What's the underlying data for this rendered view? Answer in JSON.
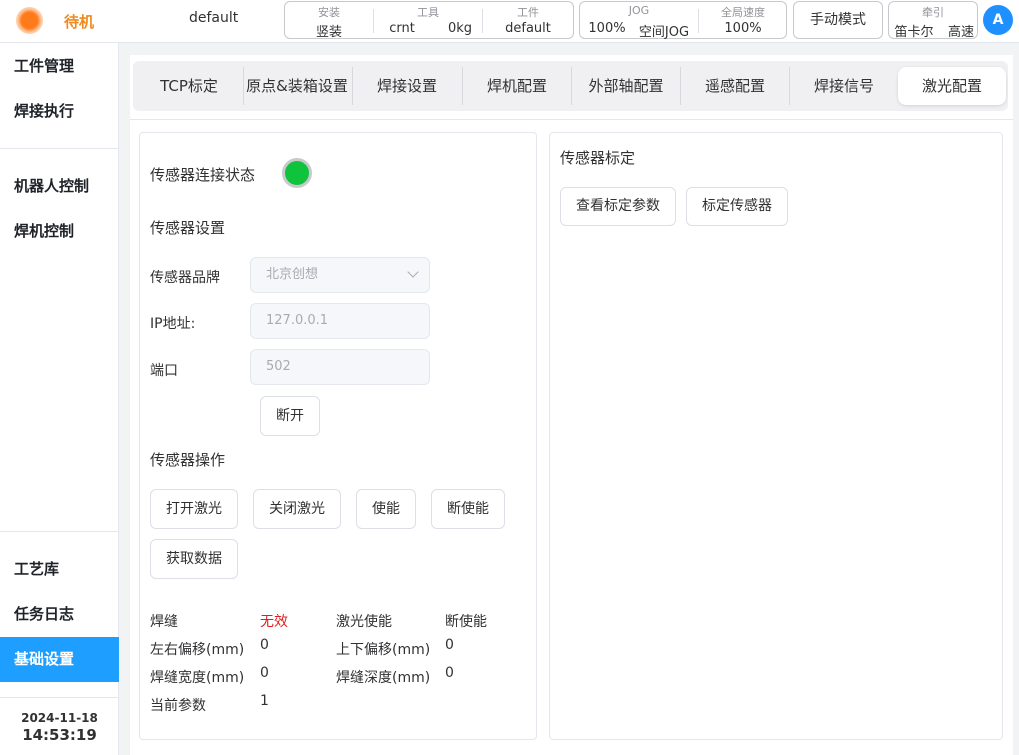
{
  "status": {
    "text": "待机",
    "dot_color": "#ff7a1a"
  },
  "program_name": "default",
  "install_group": [
    {
      "label": "安装",
      "value": "竖装"
    },
    {
      "label": "工具",
      "value": "crnt",
      "value2": "0kg"
    },
    {
      "label": "工件",
      "value": "default"
    }
  ],
  "jog_group": [
    {
      "label": "JOG",
      "value": "100%",
      "value2": "空间JOG"
    },
    {
      "label": "全局速度",
      "value": "100%"
    }
  ],
  "mode_button": "手动模式",
  "traction": {
    "label": "牵引",
    "value": "笛卡尔",
    "value2": "高速"
  },
  "avatar_letter": "A",
  "sidebar": {
    "items": [
      {
        "label": "工件管理"
      },
      {
        "label": "焊接执行"
      },
      {
        "label": "机器人控制"
      },
      {
        "label": "焊机控制"
      },
      {
        "label": "工艺库"
      },
      {
        "label": "任务日志"
      },
      {
        "label": "基础设置"
      }
    ],
    "active_index": 6,
    "date": "2024-11-18",
    "time": "14:53:19"
  },
  "tabs": [
    "TCP标定",
    "原点&装箱设置",
    "焊接设置",
    "焊机配置",
    "外部轴配置",
    "遥感配置",
    "焊接信号",
    "激光配置"
  ],
  "active_tab": "激光配置",
  "left_panel": {
    "conn_status_label": "传感器连接状态",
    "conn_status_color": "#0fc33c",
    "settings_title": "传感器设置",
    "brand_label": "传感器品牌",
    "brand_value": "北京创想",
    "ip_label": "IP地址:",
    "ip_value": "127.0.0.1",
    "port_label": "端口",
    "port_value": "502",
    "disconnect_button": "断开",
    "ops_title": "传感器操作",
    "ops_buttons": [
      "打开激光",
      "关闭激光",
      "使能",
      "断使能",
      "获取数据"
    ],
    "info": {
      "weld_label": "焊缝",
      "weld_value": "无效",
      "laser_enable_label": "激光使能",
      "laser_enable_value": "断使能",
      "lr_offset_label": "左右偏移(mm)",
      "lr_offset_value": "0",
      "ud_offset_label": "上下偏移(mm)",
      "ud_offset_value": "0",
      "width_label": "焊缝宽度(mm)",
      "width_value": "0",
      "depth_label": "焊缝深度(mm)",
      "depth_value": "0",
      "param_label": "当前参数",
      "param_value": "1"
    }
  },
  "right_panel": {
    "title": "传感器标定",
    "buttons": [
      "查看标定参数",
      "标定传感器"
    ]
  }
}
